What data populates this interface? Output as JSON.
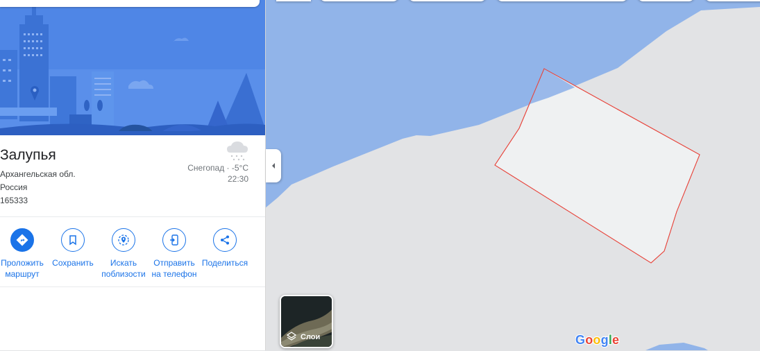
{
  "place": {
    "name": "Залупья",
    "region": "Архангельская обл.",
    "country": "Россия",
    "postal_code": "165333"
  },
  "weather": {
    "text": "Снегопад · -5°C",
    "time": "22:30",
    "icon": "snow-cloud-icon"
  },
  "actions": [
    {
      "label": "Проложить\nмаршрут",
      "icon": "directions-icon"
    },
    {
      "label": "Сохранить",
      "icon": "bookmark-icon"
    },
    {
      "label": "Искать\nпоблизости",
      "icon": "nearby-icon"
    },
    {
      "label": "Отправить\nна телефон",
      "icon": "send-to-phone-icon"
    },
    {
      "label": "Поделиться",
      "icon": "share-icon"
    }
  ],
  "map": {
    "layers_label": "Слои",
    "google_logo": "Google",
    "colors": {
      "water": "#91b4e9",
      "land": "#e2e3e5",
      "boundary": "#e8453c",
      "accent": "#1a73e8"
    }
  }
}
